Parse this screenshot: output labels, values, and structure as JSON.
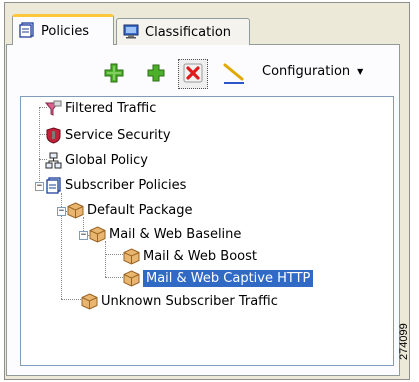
{
  "tabs": [
    {
      "label": "Policies",
      "icon": "policies-icon",
      "active": true
    },
    {
      "label": "Classification",
      "icon": "monitor-icon",
      "active": false
    }
  ],
  "toolbar": {
    "configuration_label": "Configuration",
    "buttons": [
      "add-package-icon",
      "add-policy-icon",
      "delete-icon",
      "rename-icon"
    ]
  },
  "tree": {
    "nodes": [
      {
        "label": "Filtered Traffic",
        "icon": "filter-icon",
        "level": 0
      },
      {
        "label": "Service Security",
        "icon": "shield-icon",
        "level": 0
      },
      {
        "label": "Global Policy",
        "icon": "network-icon",
        "level": 0
      },
      {
        "label": "Subscriber Policies",
        "icon": "policies-icon",
        "level": 0,
        "expanded": true
      },
      {
        "label": "Default Package",
        "icon": "package-icon",
        "level": 1,
        "expanded": true
      },
      {
        "label": "Mail & Web Baseline",
        "icon": "package-icon",
        "level": 2,
        "expanded": true
      },
      {
        "label": "Mail & Web Boost",
        "icon": "package-icon",
        "level": 3
      },
      {
        "label": "Mail & Web Captive HTTP",
        "icon": "package-icon",
        "level": 3,
        "selected": true
      },
      {
        "label": "Unknown Subscriber Traffic",
        "icon": "package-icon",
        "level": 1
      }
    ]
  },
  "figure_id": "274099"
}
